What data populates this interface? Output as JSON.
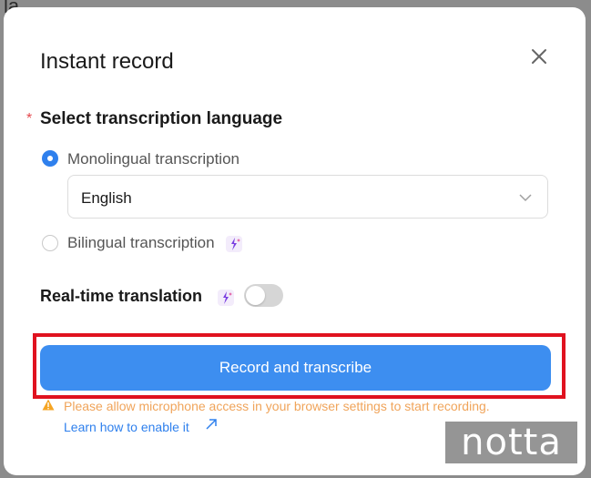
{
  "modal": {
    "title": "Instant record",
    "transcription": {
      "required_marker": "*",
      "label": "Select transcription language",
      "options": [
        {
          "label": "Monolingual transcription",
          "checked": true
        },
        {
          "label": "Bilingual transcription",
          "checked": false
        }
      ],
      "language_select": {
        "value": "English"
      }
    },
    "realtime_translation": {
      "label": "Real-time translation",
      "enabled": false
    },
    "record_button_label": "Record and transcribe",
    "warning_text": "Please allow microphone access in your browser settings to start recording.",
    "learn_link_label": "Learn how to enable it"
  },
  "watermark": "notta",
  "background_page": {
    "partial_heading": "la"
  },
  "colors": {
    "primary": "#3d8ef0",
    "highlight": "#e0121f",
    "warning": "#f0a45a",
    "link": "#2f80ed",
    "required": "#e5484d"
  }
}
